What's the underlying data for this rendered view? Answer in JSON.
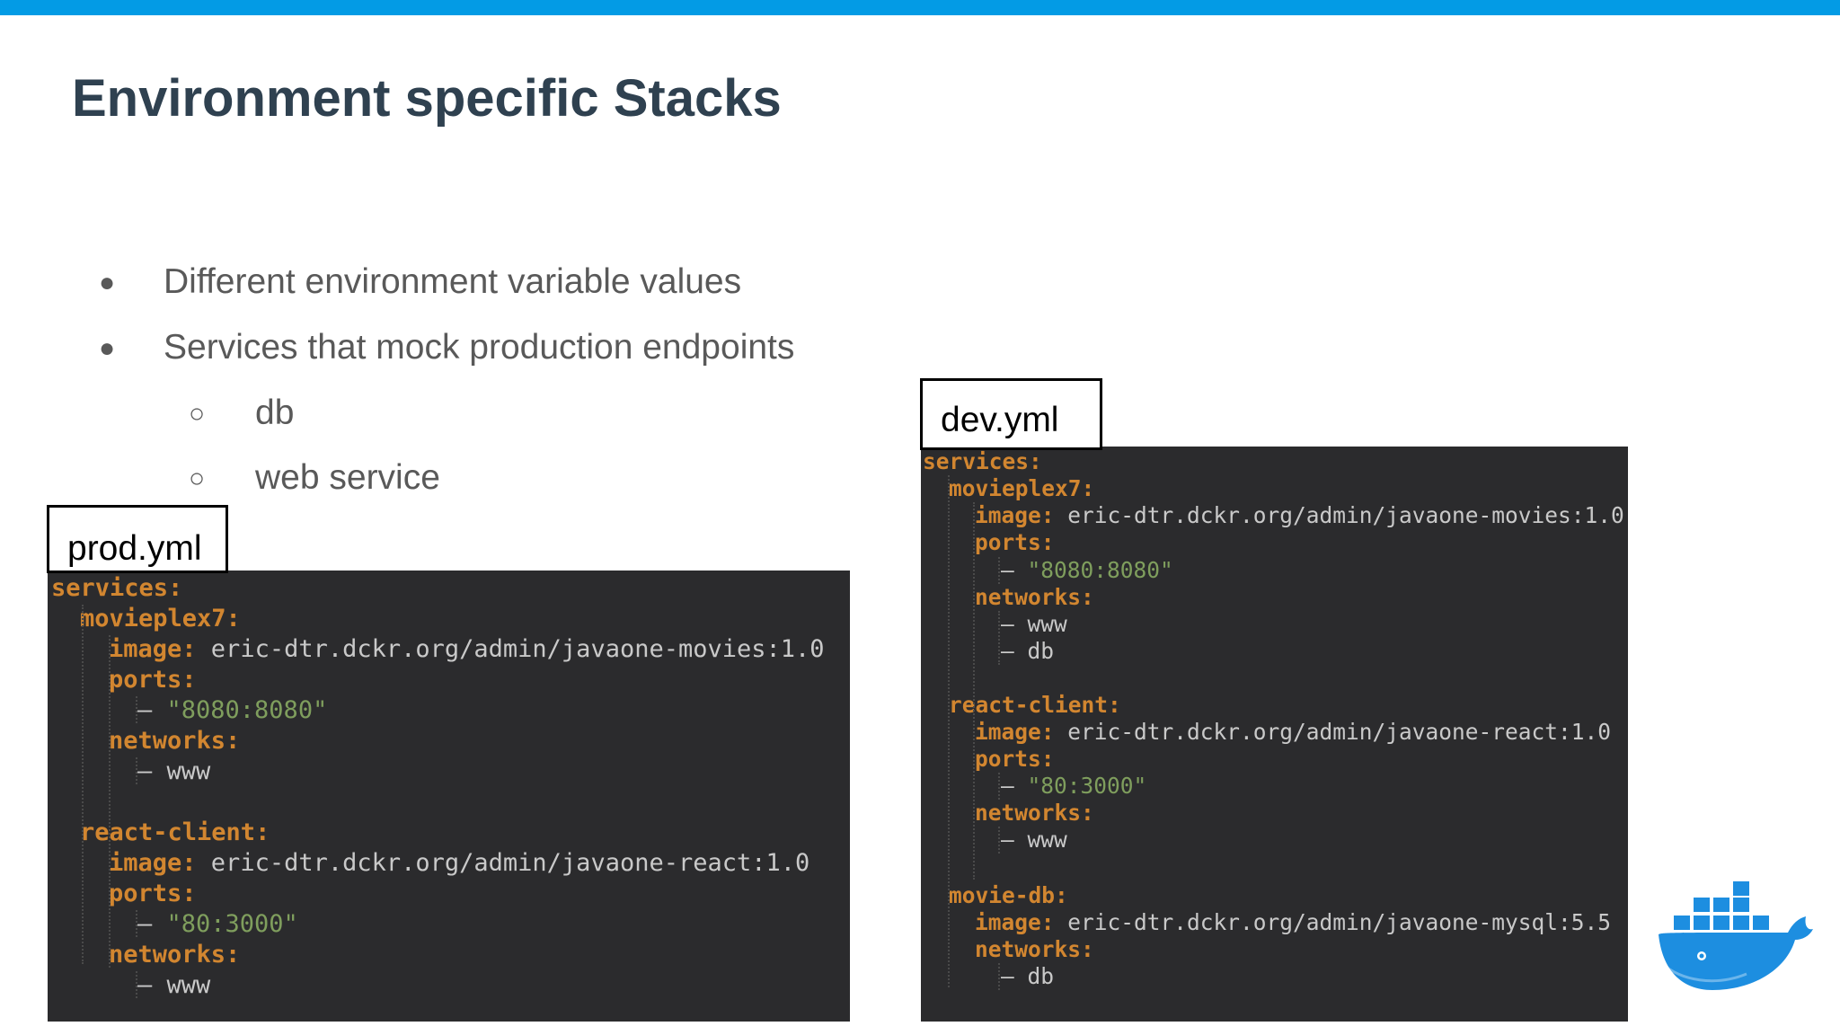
{
  "slide": {
    "title": "Environment specific Stacks",
    "bullets": [
      {
        "marker": "●",
        "text": "Different environment variable values"
      },
      {
        "marker": "●",
        "text": "Services that mock production endpoints"
      }
    ],
    "sub_bullets": [
      {
        "marker": "○",
        "text": "db"
      },
      {
        "marker": "○",
        "text": "web service"
      }
    ]
  },
  "prod": {
    "label": "prod.yml",
    "lines": [
      {
        "k": "services:",
        "v": ""
      },
      {
        "k": "movieplex7:",
        "v": ""
      },
      {
        "k": "image:",
        "v": " eric-dtr.dckr.org/admin/javaone-movies:1.0"
      },
      {
        "k": "ports:",
        "v": ""
      },
      {
        "d": "– ",
        "s": "\"8080:8080\""
      },
      {
        "k": "networks:",
        "v": ""
      },
      {
        "d": "– ",
        "v": "www"
      },
      {
        "k": "",
        "v": ""
      },
      {
        "k": "react-client:",
        "v": ""
      },
      {
        "k": "image:",
        "v": " eric-dtr.dckr.org/admin/javaone-react:1.0"
      },
      {
        "k": "ports:",
        "v": ""
      },
      {
        "d": "– ",
        "s": "\"80:3000\""
      },
      {
        "k": "networks:",
        "v": ""
      },
      {
        "d": "– ",
        "v": "www"
      }
    ]
  },
  "dev": {
    "label": "dev.yml",
    "lines": [
      {
        "k": "services:",
        "v": ""
      },
      {
        "k": "movieplex7:",
        "v": ""
      },
      {
        "k": "image:",
        "v": " eric-dtr.dckr.org/admin/javaone-movies:1.0"
      },
      {
        "k": "ports:",
        "v": ""
      },
      {
        "d": "– ",
        "s": "\"8080:8080\""
      },
      {
        "k": "networks:",
        "v": ""
      },
      {
        "d": "– ",
        "v": "www"
      },
      {
        "d": "– ",
        "v": "db"
      },
      {
        "k": "",
        "v": ""
      },
      {
        "k": "react-client:",
        "v": ""
      },
      {
        "k": "image:",
        "v": " eric-dtr.dckr.org/admin/javaone-react:1.0"
      },
      {
        "k": "ports:",
        "v": ""
      },
      {
        "d": "– ",
        "s": "\"80:3000\""
      },
      {
        "k": "networks:",
        "v": ""
      },
      {
        "d": "– ",
        "v": "www"
      },
      {
        "k": "",
        "v": ""
      },
      {
        "k": "movie-db:",
        "v": ""
      },
      {
        "k": "image:",
        "v": " eric-dtr.dckr.org/admin/javaone-mysql:5.5"
      },
      {
        "k": "networks:",
        "v": ""
      },
      {
        "d": "– ",
        "v": "db"
      }
    ]
  },
  "logo": {
    "icon": "docker-whale-icon"
  },
  "colors": {
    "accent_bar": "#039be5",
    "title": "#2f4150",
    "code_bg": "#2b2b2d",
    "key": "#d28630",
    "string": "#7f9e5d"
  }
}
